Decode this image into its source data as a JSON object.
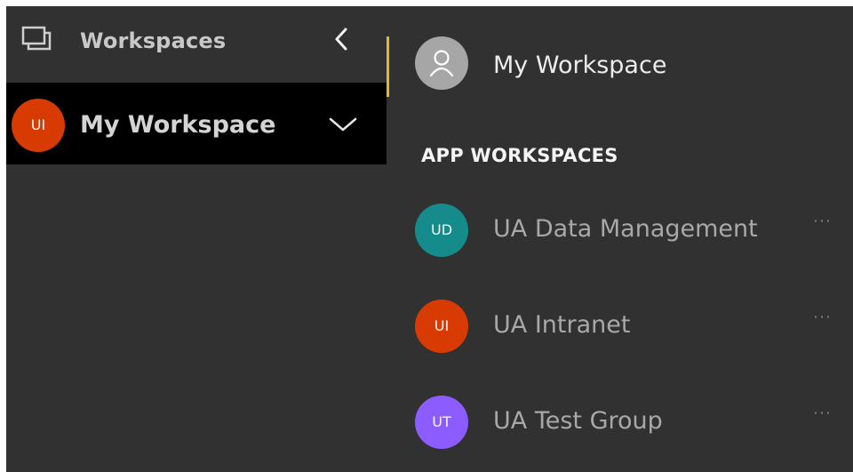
{
  "colors": {
    "background": "#313131",
    "selected_row": "#000000",
    "accent": "#e6b820"
  },
  "nav": {
    "title": "Workspaces",
    "title_icon": "workspaces-icon",
    "collapse_icon": "chevron-left-icon",
    "selected": {
      "initials": "UI",
      "label": "My Workspace",
      "avatar_color": "#d83b01",
      "expand_icon": "chevron-down-icon"
    }
  },
  "flyout": {
    "my_workspace": {
      "label": "My Workspace",
      "avatar_icon": "person-icon"
    },
    "section_heading": "APP WORKSPACES",
    "workspaces": [
      {
        "initials": "UD",
        "label": "UA Data Management",
        "avatar_color": "#168b8b",
        "more": "···"
      },
      {
        "initials": "UI",
        "label": "UA Intranet",
        "avatar_color": "#d83b01",
        "more": "···"
      },
      {
        "initials": "UT",
        "label": "UA Test Group",
        "avatar_color": "#8c5cff",
        "more": "···"
      }
    ]
  }
}
